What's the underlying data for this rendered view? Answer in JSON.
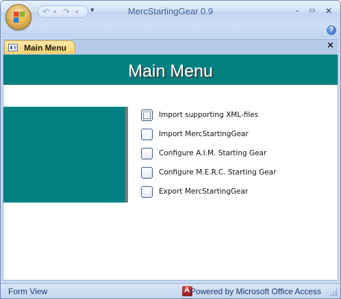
{
  "window": {
    "title": "MercStartingGear 0.9",
    "controls": {
      "minimize": "–",
      "restore": "▭",
      "close": "✕"
    }
  },
  "quick_access": {
    "undo": "↶",
    "undo_dropdown": "▾",
    "redo": "↷",
    "redo_dropdown": "▾",
    "customize": "▾"
  },
  "help": {
    "label": "?"
  },
  "tab": {
    "label": "Main Menu",
    "close": "×"
  },
  "form": {
    "header_title": "Main Menu",
    "header_color": "#008080",
    "menu_items": [
      {
        "label": "Import supporting XML-files",
        "focused": true
      },
      {
        "label": "Import MercStartingGear",
        "focused": false
      },
      {
        "label": "Configure A.I.M. Starting Gear",
        "focused": false
      },
      {
        "label": "Configure M.E.R.C. Starting Gear",
        "focused": false
      },
      {
        "label": "Export MercStartingGear",
        "focused": false
      }
    ]
  },
  "statusbar": {
    "view": "Form View",
    "powered_by": "Powered by Microsoft Office Access"
  }
}
